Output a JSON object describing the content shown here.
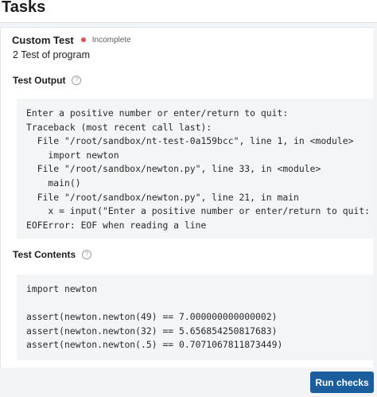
{
  "header": {
    "title": "Tasks"
  },
  "test": {
    "name": "Custom Test",
    "status": "Incomplete",
    "status_color": "#d9534f",
    "description": "2 Test of program"
  },
  "output_section": {
    "title": "Test Output",
    "help_icon": "question-circle-icon",
    "lines": [
      "Enter a positive number or enter/return to quit:",
      "Traceback (most recent call last):",
      "  File \"/root/sandbox/nt-test-0a159bcc\", line 1, in <module>",
      "    import newton",
      "  File \"/root/sandbox/newton.py\", line 33, in <module>",
      "    main()",
      "  File \"/root/sandbox/newton.py\", line 21, in main",
      "    x = input(\"Enter a positive number or enter/return to quit: \")",
      "EOFError: EOF when reading a line"
    ]
  },
  "contents_section": {
    "title": "Test Contents",
    "help_icon": "question-circle-icon",
    "lines": [
      "import newton",
      "",
      "assert(newton.newton(49) == 7.000000000000002)",
      "assert(newton.newton(32) == 5.656854250817683)",
      "assert(newton.newton(.5) == 0.7071067811873449)"
    ]
  },
  "footer": {
    "run_label": "Run checks",
    "run_color": "#1b5e9e"
  }
}
